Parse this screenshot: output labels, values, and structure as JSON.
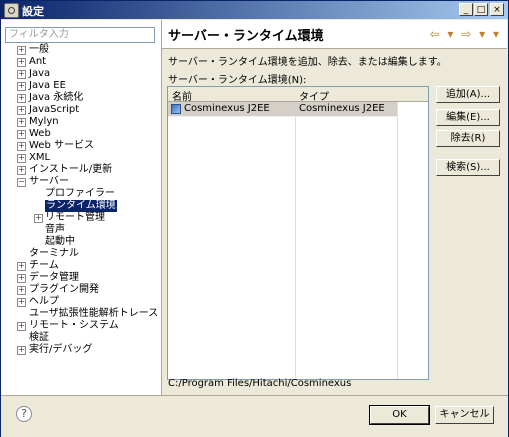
{
  "window": {
    "title": "設定",
    "controls": [
      "_",
      "□",
      "×"
    ]
  },
  "sidebar": {
    "filter_placeholder": "フィルタ入力",
    "items": [
      {
        "label": "一般",
        "expander": "+"
      },
      {
        "label": "Ant",
        "expander": "+"
      },
      {
        "label": "Java",
        "expander": "+"
      },
      {
        "label": "Java EE",
        "expander": "+"
      },
      {
        "label": "Java 永続化",
        "expander": "+"
      },
      {
        "label": "JavaScript",
        "expander": "+"
      },
      {
        "label": "Mylyn",
        "expander": "+"
      },
      {
        "label": "Web",
        "expander": "+"
      },
      {
        "label": "Web サービス",
        "expander": "+"
      },
      {
        "label": "XML",
        "expander": "+"
      },
      {
        "label": "インストール/更新",
        "expander": "+"
      },
      {
        "label": "サーバー",
        "expander": "−"
      },
      {
        "label": "プロファイラー",
        "expander": ""
      },
      {
        "label": "ランタイム環境",
        "expander": ""
      },
      {
        "label": "リモート管理",
        "expander": "+"
      },
      {
        "label": "音声",
        "expander": ""
      },
      {
        "label": "起動中",
        "expander": ""
      },
      {
        "label": "ターミナル",
        "expander": ""
      },
      {
        "label": "チーム",
        "expander": "+"
      },
      {
        "label": "データ管理",
        "expander": "+"
      },
      {
        "label": "プラグイン開発",
        "expander": "+"
      },
      {
        "label": "ヘルプ",
        "expander": "+"
      },
      {
        "label": "ユーザ拡張性能解析トレース",
        "expander": ""
      },
      {
        "label": "リモート・システム",
        "expander": "+"
      },
      {
        "label": "検証",
        "expander": ""
      },
      {
        "label": "実行/デバッグ",
        "expander": "+"
      }
    ]
  },
  "main": {
    "title": "サーバー・ランタイム環境",
    "nav_arrows": "⇦ ▾ ⇨ ▾ ▾",
    "description": "サーバー・ランタイム環境を追加、除去、または編集します。",
    "list_label": "サーバー・ランタイム環境(N):",
    "columns": [
      "名前",
      "タイプ"
    ],
    "rows": [
      {
        "name": "Cosminexus J2EE",
        "type": "Cosminexus J2EE"
      }
    ],
    "buttons": {
      "add": "追加(A)...",
      "edit": "編集(E)...",
      "remove": "除去(R)",
      "search": "検索(S)..."
    },
    "path": "C:/Program Files/Hitachi/Cosminexus"
  },
  "footer": {
    "help_icon": "?",
    "ok": "OK",
    "cancel": "キャンセル"
  }
}
